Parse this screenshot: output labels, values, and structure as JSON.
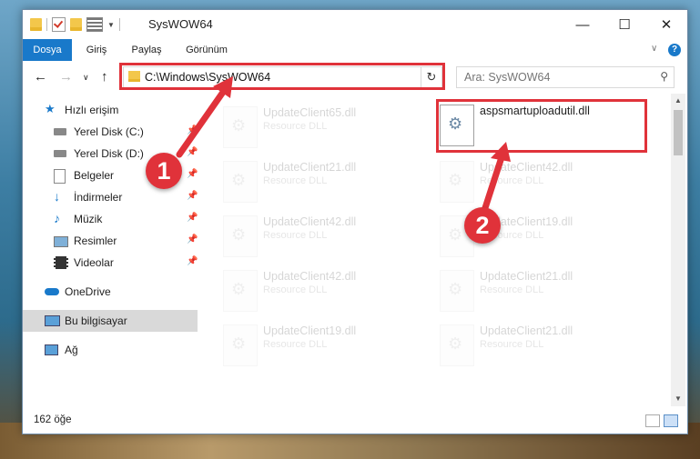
{
  "window": {
    "title": "SysWOW64"
  },
  "ribbon": {
    "tabs": [
      "Dosya",
      "Giriş",
      "Paylaş",
      "Görünüm"
    ]
  },
  "navigation": {
    "address": "C:\\Windows\\SysWOW64",
    "search_placeholder": "Ara: SysWOW64"
  },
  "sidebar": {
    "items": [
      {
        "label": "Hızlı erişim",
        "icon": "star-icon"
      },
      {
        "label": "Yerel Disk (C:)",
        "icon": "drive-icon"
      },
      {
        "label": "Yerel Disk (D:)",
        "icon": "drive-icon"
      },
      {
        "label": "Belgeler",
        "icon": "documents-icon"
      },
      {
        "label": "İndirmeler",
        "icon": "download-icon"
      },
      {
        "label": "Müzik",
        "icon": "music-icon"
      },
      {
        "label": "Resimler",
        "icon": "pictures-icon"
      },
      {
        "label": "Videolar",
        "icon": "video-icon"
      },
      {
        "label": "OneDrive",
        "icon": "cloud-icon"
      },
      {
        "label": "Bu bilgisayar",
        "icon": "computer-icon"
      },
      {
        "label": "Ağ",
        "icon": "network-icon"
      }
    ]
  },
  "files": [
    {
      "name": "UpdateClient65.dll",
      "type": "Resource DLL"
    },
    {
      "name": "aspsmartuploadutil.dll",
      "type": ""
    },
    {
      "name": "UpdateClient21.dll",
      "type": "Resource DLL"
    },
    {
      "name": "UpdateClient42.dll",
      "type": "Resource DLL"
    },
    {
      "name": "UpdateClient42.dll",
      "type": "Resource DLL"
    },
    {
      "name": "UpdateClient19.dll",
      "type": "Resource DLL"
    },
    {
      "name": "UpdateClient42.dll",
      "type": "Resource DLL"
    },
    {
      "name": "UpdateClient21.dll",
      "type": "Resource DLL"
    },
    {
      "name": "UpdateClient19.dll",
      "type": "Resource DLL"
    },
    {
      "name": "UpdateClient21.dll",
      "type": "Resource DLL"
    }
  ],
  "status": {
    "item_count": "162 öğe"
  },
  "annotations": {
    "badge1": "1",
    "badge2": "2"
  },
  "colors": {
    "accent": "#1979ca",
    "callout": "#e0323a"
  }
}
